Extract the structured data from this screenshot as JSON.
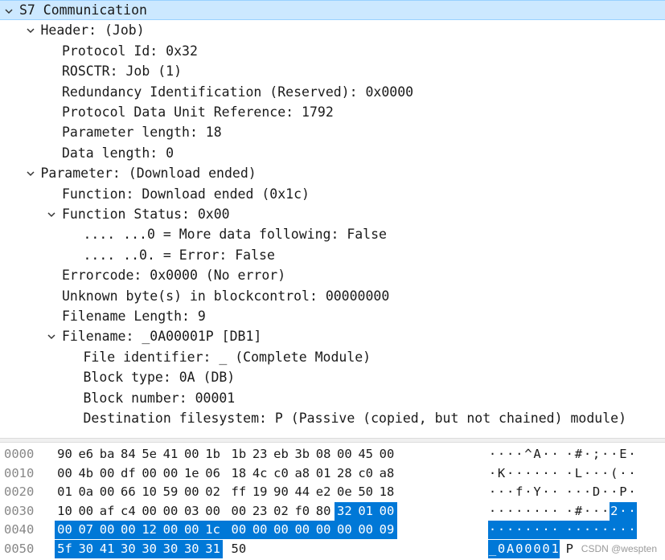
{
  "tree": [
    {
      "level": 0,
      "expanded": true,
      "selected": true,
      "label": "S7 Communication"
    },
    {
      "level": 1,
      "expanded": true,
      "label": "Header: (Job)"
    },
    {
      "level": 2,
      "label": "Protocol Id: 0x32"
    },
    {
      "level": 2,
      "label": "ROSCTR: Job (1)"
    },
    {
      "level": 2,
      "label": "Redundancy Identification (Reserved): 0x0000"
    },
    {
      "level": 2,
      "label": "Protocol Data Unit Reference: 1792"
    },
    {
      "level": 2,
      "label": "Parameter length: 18"
    },
    {
      "level": 2,
      "label": "Data length: 0"
    },
    {
      "level": 1,
      "expanded": true,
      "label": "Parameter: (Download ended)"
    },
    {
      "level": 2,
      "label": "Function: Download ended (0x1c)"
    },
    {
      "level": 2,
      "expanded": true,
      "label": "Function Status: 0x00"
    },
    {
      "level": 3,
      "label": ".... ...0 = More data following: False"
    },
    {
      "level": 3,
      "label": ".... ..0. = Error: False"
    },
    {
      "level": 2,
      "label": "Errorcode: 0x0000 (No error)"
    },
    {
      "level": 2,
      "label": "Unknown byte(s) in blockcontrol: 00000000"
    },
    {
      "level": 2,
      "label": "Filename Length: 9"
    },
    {
      "level": 2,
      "expanded": true,
      "label": "Filename: _0A00001P [DB1]"
    },
    {
      "level": 3,
      "label": "File identifier: _ (Complete Module)"
    },
    {
      "level": 3,
      "label": "Block type: 0A (DB)"
    },
    {
      "level": 3,
      "label": "Block number: 00001"
    },
    {
      "level": 3,
      "label": "Destination filesystem: P (Passive (copied, but not chained) module)"
    }
  ],
  "bytes": {
    "rows": [
      {
        "offset": "0000",
        "hex": [
          "90",
          "e6",
          "ba",
          "84",
          "5e",
          "41",
          "00",
          "1b",
          "1b",
          "23",
          "eb",
          "3b",
          "08",
          "00",
          "45",
          "00"
        ],
        "ascii": [
          "·",
          "·",
          "·",
          "·",
          "^",
          "A",
          "·",
          "·",
          "·",
          "#",
          "·",
          ";",
          "·",
          "·",
          "E",
          "·"
        ]
      },
      {
        "offset": "0010",
        "hex": [
          "00",
          "4b",
          "00",
          "df",
          "00",
          "00",
          "1e",
          "06",
          "18",
          "4c",
          "c0",
          "a8",
          "01",
          "28",
          "c0",
          "a8"
        ],
        "ascii": [
          "·",
          "K",
          "·",
          "·",
          "·",
          "·",
          "·",
          "·",
          "·",
          "L",
          "·",
          "·",
          "·",
          "(",
          "·",
          "·"
        ]
      },
      {
        "offset": "0020",
        "hex": [
          "01",
          "0a",
          "00",
          "66",
          "10",
          "59",
          "00",
          "02",
          "ff",
          "19",
          "90",
          "44",
          "e2",
          "0e",
          "50",
          "18"
        ],
        "ascii": [
          "·",
          "·",
          "·",
          "f",
          "·",
          "Y",
          "·",
          "·",
          "·",
          "·",
          "·",
          "D",
          "·",
          "·",
          "P",
          "·"
        ]
      },
      {
        "offset": "0030",
        "hex": [
          "10",
          "00",
          "af",
          "c4",
          "00",
          "00",
          "03",
          "00",
          "00",
          "23",
          "02",
          "f0",
          "80",
          "32",
          "01",
          "00"
        ],
        "ascii": [
          "·",
          "·",
          "·",
          "·",
          "·",
          "·",
          "·",
          "·",
          "·",
          "#",
          "·",
          "·",
          "·",
          "2",
          "·",
          "·"
        ]
      },
      {
        "offset": "0040",
        "hex": [
          "00",
          "07",
          "00",
          "00",
          "12",
          "00",
          "00",
          "1c",
          "00",
          "00",
          "00",
          "00",
          "00",
          "00",
          "00",
          "09"
        ],
        "ascii": [
          "·",
          "·",
          "·",
          "·",
          "·",
          "·",
          "·",
          "·",
          "·",
          "·",
          "·",
          "·",
          "·",
          "·",
          "·",
          "·"
        ]
      },
      {
        "offset": "0050",
        "hex": [
          "5f",
          "30",
          "41",
          "30",
          "30",
          "30",
          "30",
          "31",
          "50"
        ],
        "ascii": [
          "_",
          "0",
          "A",
          "0",
          "0",
          "0",
          "0",
          "1",
          "P"
        ]
      }
    ],
    "highlight_start": 61,
    "highlight_end": 88
  },
  "watermark": "CSDN @wespten",
  "colors": {
    "selected_row": "#cce8ff",
    "byte_highlight": "#0078d7",
    "offset_text": "#888888"
  }
}
